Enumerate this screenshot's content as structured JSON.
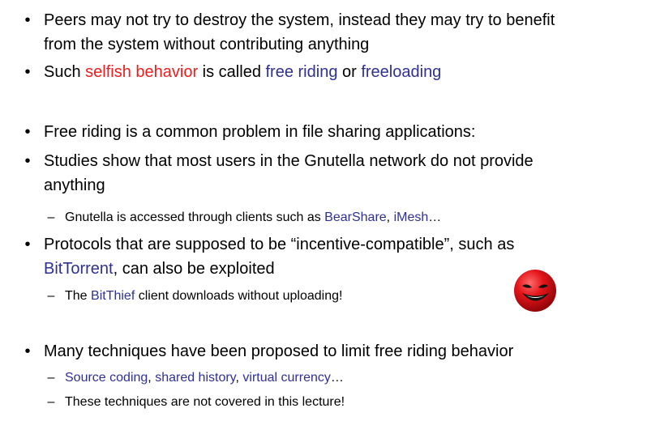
{
  "bullet_mark": "•",
  "sub_mark": "–",
  "b1": {
    "line1": "Peers may not try to destroy the system, instead they may try to benefit",
    "line2": "from the system without contributing anything"
  },
  "b2": {
    "pre": "Such ",
    "hl1": "selfish behavior",
    "mid": " is called ",
    "hl2": "free riding",
    "or": " or ",
    "hl3": "freeloading"
  },
  "b3": {
    "text": "Free riding is a common problem in file sharing applications:"
  },
  "b4": {
    "line1": "Studies show that most users in the Gnutella network do not provide",
    "line2": "anything"
  },
  "s1": {
    "pre": "Gnutella is accessed through clients such as ",
    "hl1": "BearShare",
    "sep": ", ",
    "hl2": "iMesh",
    "post": "…"
  },
  "b5": {
    "line1": "Protocols that are supposed to be “incentive-compatible”, such as",
    "hl": "BitTorrent",
    "post": ", can also be exploited"
  },
  "s2": {
    "pre": "The ",
    "hl": "BitThief",
    "post": " client downloads without uploading!"
  },
  "b6": {
    "text": "Many techniques have been proposed to limit free riding behavior"
  },
  "s3": {
    "hl1": "Source coding",
    "sep1": ", ",
    "hl2": "shared history",
    "sep2": ", ",
    "hl3": "virtual currency",
    "post": "…"
  },
  "s4": {
    "text": "These techniques are not covered in this lecture!"
  },
  "colors": {
    "highlight_red": "#ee1c1c",
    "highlight_blue": "#2e3192",
    "face_red": "#e3151a"
  },
  "icons": {
    "face": "grinning-face-icon"
  }
}
